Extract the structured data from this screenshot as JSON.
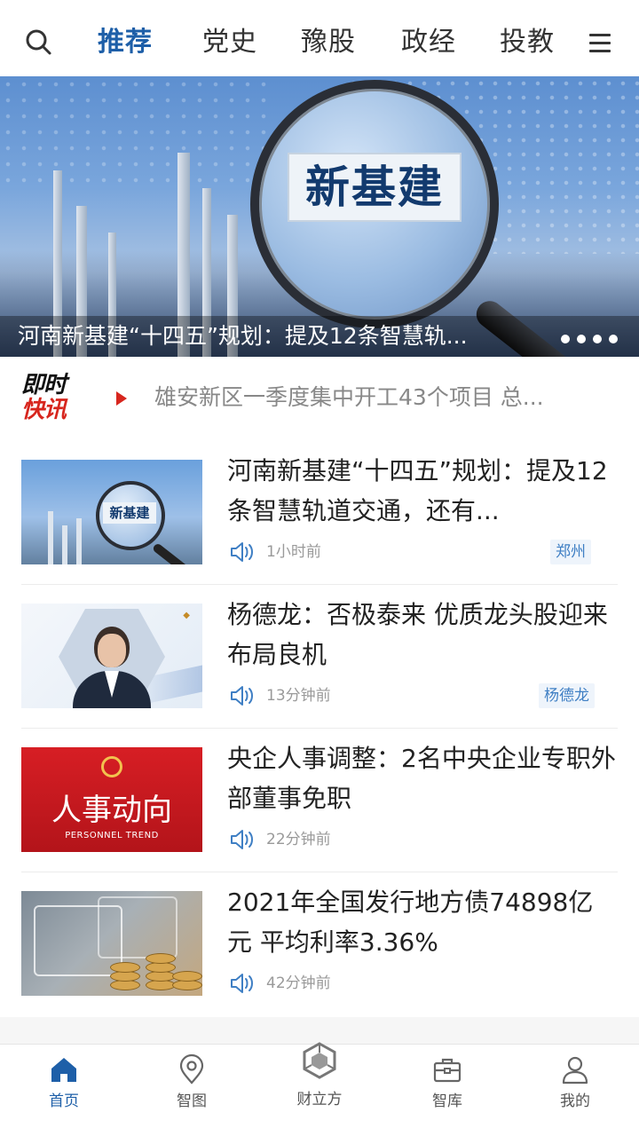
{
  "topnav": {
    "tabs": [
      {
        "label": "推荐",
        "active": true
      },
      {
        "label": "党史",
        "active": false
      },
      {
        "label": "豫股",
        "active": false
      },
      {
        "label": "政经",
        "active": false
      },
      {
        "label": "投教",
        "active": false
      }
    ],
    "search_icon": "search-icon",
    "menu_icon": "hamburger-menu-icon",
    "active_color": "#1e5fa8"
  },
  "banner": {
    "image_text": "新基建",
    "title": "河南新基建“十四五”规划：提及12条智慧轨...",
    "dots": 4
  },
  "flash": {
    "logo_line1": "即时",
    "logo_line2": "快讯",
    "text": "雄安新区一季度集中开工43个项目 总..."
  },
  "news": [
    {
      "title": "河南新基建“十四五”规划：提及12条智慧轨道交通，还有...",
      "thumb_text": "新基建",
      "time": "1小时前",
      "tag": "郑州"
    },
    {
      "title": "杨德龙：否极泰来 优质龙头股迎来布局良机",
      "time": "13分钟前",
      "tag": "杨德龙"
    },
    {
      "title": "央企人事调整：2名中央企业专职外部董事免职",
      "thumb_big": "人事动向",
      "thumb_en": "PERSONNEL TREND",
      "time": "22分钟前",
      "tag": ""
    },
    {
      "title": "2021年全国发行地方债74898亿元 平均利率3.36%",
      "time": "42分钟前",
      "tag": ""
    }
  ],
  "bottomnav": {
    "items": [
      {
        "label": "首页",
        "icon": "home-icon",
        "active": true
      },
      {
        "label": "智图",
        "icon": "location-pin-icon",
        "active": false
      },
      {
        "label": "财立方",
        "icon": "cube-logo-icon",
        "active": false
      },
      {
        "label": "智库",
        "icon": "briefcase-icon",
        "active": false
      },
      {
        "label": "我的",
        "icon": "user-icon",
        "active": false
      }
    ]
  },
  "colors": {
    "accent": "#1e5fa8",
    "flash_red": "#d7261e",
    "tag_bg": "#eef4fb",
    "tag_text": "#3f7fc4"
  }
}
